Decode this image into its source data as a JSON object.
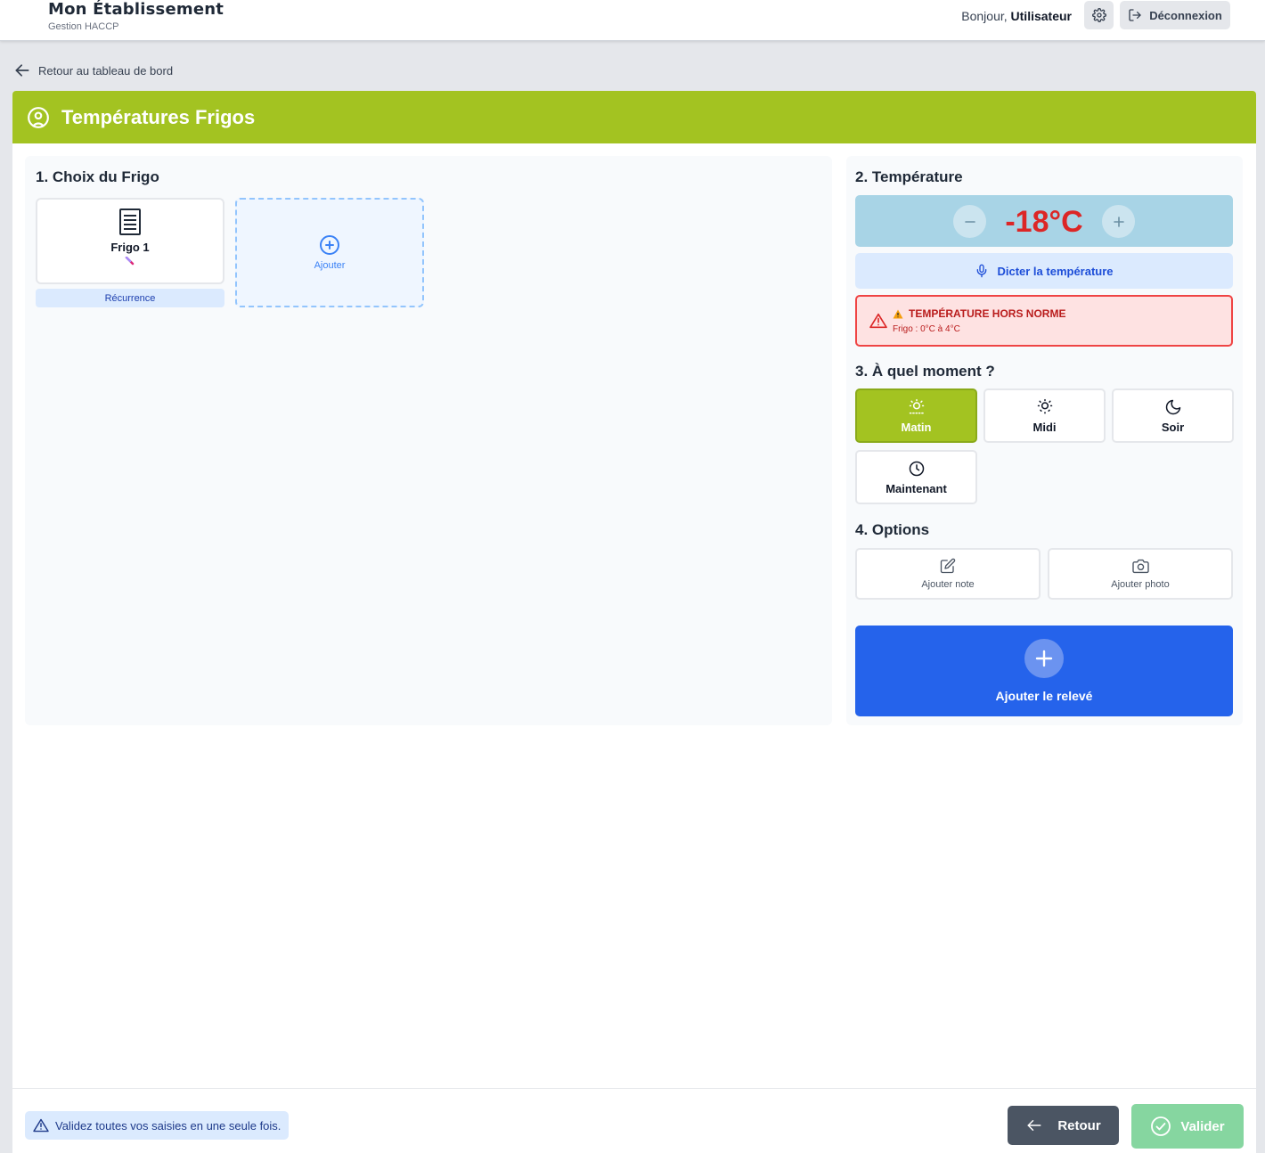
{
  "header": {
    "title": "Mon Établissement",
    "subtitle": "Gestion HACCP",
    "greeting": "Bonjour,",
    "user": "Utilisateur",
    "settings_icon": "gear-icon",
    "logout_label": "Déconnexion"
  },
  "back_link": {
    "label": "Retour au tableau de bord"
  },
  "page": {
    "title": "Températures Frigos",
    "title_color": "#a3c321"
  },
  "frigo_section": {
    "title": "1. Choix du Frigo",
    "items": [
      {
        "name": "Frigo 1",
        "tag": "Récurrence"
      }
    ],
    "add_label": "Ajouter"
  },
  "temperature_section": {
    "title": "2. Température",
    "value": "-18°C",
    "value_color": "#dc2626",
    "dictate_label": "Dicter la température",
    "alert": {
      "title": "TEMPÉRATURE HORS NORME",
      "detail": "Frigo : 0°C à 4°C"
    }
  },
  "moment_section": {
    "title": "3. À quel moment ?",
    "options": [
      {
        "label": "Matin",
        "icon": "sunrise-icon",
        "selected": true
      },
      {
        "label": "Midi",
        "icon": "sun-icon",
        "selected": false
      },
      {
        "label": "Soir",
        "icon": "moon-icon",
        "selected": false
      },
      {
        "label": "Maintenant",
        "icon": "clock-icon",
        "selected": false
      }
    ]
  },
  "options_section": {
    "title": "4. Options",
    "note_label": "Ajouter note",
    "photo_label": "Ajouter photo"
  },
  "add_button": {
    "label": "Ajouter le relevé",
    "color": "#2563eb"
  },
  "footer": {
    "note": "Validez toutes vos saisies en une seule fois.",
    "back_label": "Retour",
    "validate_label": "Valider"
  }
}
